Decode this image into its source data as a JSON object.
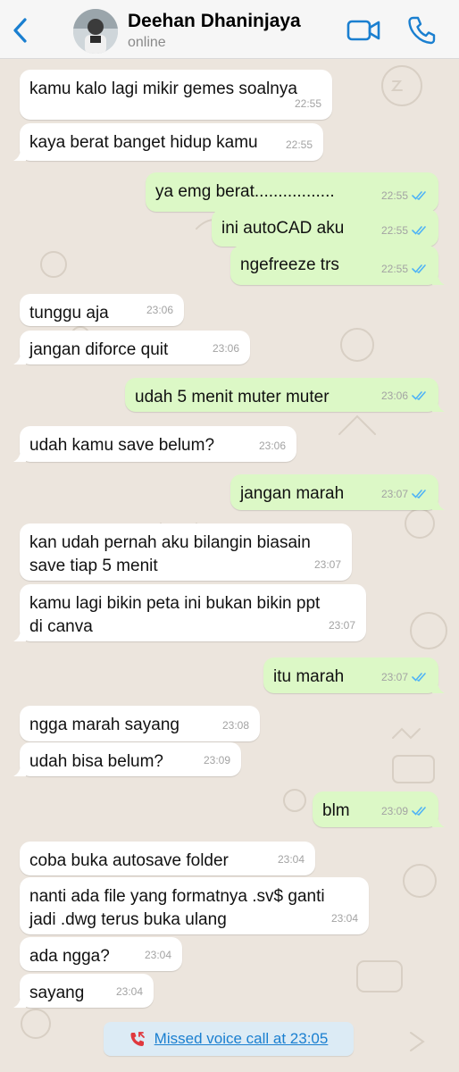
{
  "header": {
    "contact_name": "Deehan Dhaninjaya",
    "status": "online",
    "icons": [
      "chevron-left-icon",
      "avatar",
      "video-camera-icon",
      "phone-icon"
    ],
    "accent_color": "#1a7fd0"
  },
  "colors": {
    "background": "#ece5dd",
    "incoming_bubble": "#ffffff",
    "outgoing_bubble": "#dcf8c6",
    "read_ticks": "#4fb3f6"
  },
  "messages": [
    {
      "dir": "in",
      "text": "kamu kalo lagi mikir gemes soalnya",
      "time": "22:55"
    },
    {
      "dir": "in",
      "text": "kaya berat banget hidup kamu",
      "time": "22:55"
    },
    {
      "dir": "out",
      "text": "ya emg berat.................",
      "time": "22:55"
    },
    {
      "dir": "out",
      "text": "ini autoCAD aku",
      "time": "22:55"
    },
    {
      "dir": "out",
      "text": "ngefreeze trs",
      "time": "22:55"
    },
    {
      "dir": "in",
      "text": "tunggu aja",
      "time": "23:06"
    },
    {
      "dir": "in",
      "text": "jangan diforce quit",
      "time": "23:06"
    },
    {
      "dir": "out",
      "text": "udah 5 menit muter muter",
      "time": "23:06"
    },
    {
      "dir": "in",
      "text": "udah kamu save belum?",
      "time": "23:06"
    },
    {
      "dir": "out",
      "text": "jangan marah",
      "time": "23:07"
    },
    {
      "dir": "in",
      "text": "kan udah pernah aku bilangin biasain\nsave tiap 5 menit",
      "time": "23:07"
    },
    {
      "dir": "in",
      "text": "kamu lagi bikin peta ini bukan bikin ppt\ndi canva",
      "time": "23:07"
    },
    {
      "dir": "out",
      "text": "itu marah",
      "time": "23:07"
    },
    {
      "dir": "in",
      "text": "ngga marah sayang",
      "time": "23:08"
    },
    {
      "dir": "in",
      "text": "udah bisa belum?",
      "time": "23:09"
    },
    {
      "dir": "out",
      "text": "blm",
      "time": "23:09"
    },
    {
      "dir": "in",
      "text": "coba buka autosave folder",
      "time": "23:04"
    },
    {
      "dir": "in",
      "text": "nanti ada file yang formatnya .sv$ ganti\njadi .dwg terus buka ulang",
      "time": "23:04"
    },
    {
      "dir": "in",
      "text": "ada ngga?",
      "time": "23:04"
    },
    {
      "dir": "in",
      "text": "sayang",
      "time": "23:04"
    }
  ],
  "missed_call": {
    "label": "Missed voice call at 23:05",
    "icon": "missed-call-icon"
  }
}
